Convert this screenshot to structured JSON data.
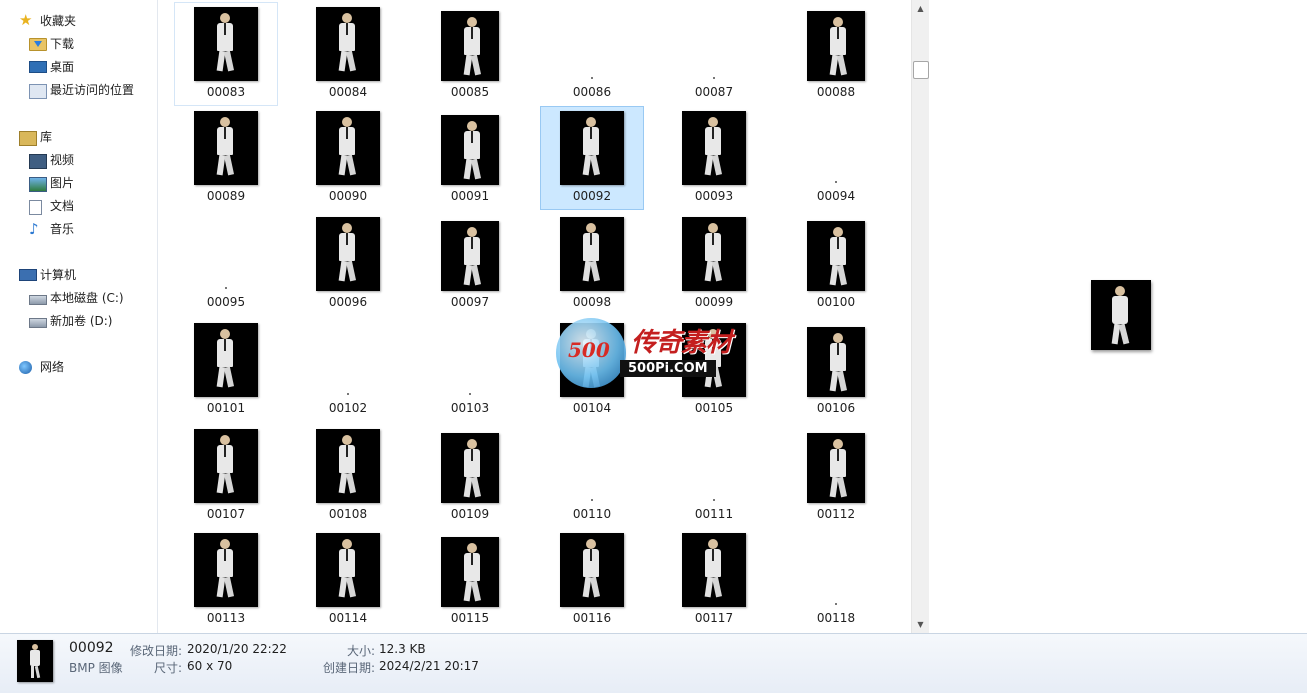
{
  "nav": {
    "favorites": {
      "label": "收藏夹",
      "items": [
        {
          "label": "下载"
        },
        {
          "label": "桌面"
        },
        {
          "label": "最近访问的位置"
        }
      ]
    },
    "libraries": {
      "label": "库",
      "items": [
        {
          "label": "视频"
        },
        {
          "label": "图片"
        },
        {
          "label": "文档"
        },
        {
          "label": "音乐"
        }
      ]
    },
    "computer": {
      "label": "计算机",
      "items": [
        {
          "label": "本地磁盘 (C:)"
        },
        {
          "label": "新加卷 (D:)"
        }
      ]
    },
    "network": {
      "label": "网络"
    }
  },
  "files": [
    {
      "name": "00083",
      "thumb": true,
      "state": "hover"
    },
    {
      "name": "00084",
      "thumb": true
    },
    {
      "name": "00085",
      "thumb": true
    },
    {
      "name": "00086",
      "thumb": false
    },
    {
      "name": "00087",
      "thumb": false
    },
    {
      "name": "00088",
      "thumb": true
    },
    {
      "name": "00089",
      "thumb": true
    },
    {
      "name": "00090",
      "thumb": true
    },
    {
      "name": "00091",
      "thumb": true
    },
    {
      "name": "00092",
      "thumb": true,
      "state": "selected"
    },
    {
      "name": "00093",
      "thumb": true
    },
    {
      "name": "00094",
      "thumb": false
    },
    {
      "name": "00095",
      "thumb": false
    },
    {
      "name": "00096",
      "thumb": true
    },
    {
      "name": "00097",
      "thumb": true
    },
    {
      "name": "00098",
      "thumb": true
    },
    {
      "name": "00099",
      "thumb": true
    },
    {
      "name": "00100",
      "thumb": true
    },
    {
      "name": "00101",
      "thumb": true
    },
    {
      "name": "00102",
      "thumb": false
    },
    {
      "name": "00103",
      "thumb": false
    },
    {
      "name": "00104",
      "thumb": true
    },
    {
      "name": "00105",
      "thumb": true
    },
    {
      "name": "00106",
      "thumb": true
    },
    {
      "name": "00107",
      "thumb": true
    },
    {
      "name": "00108",
      "thumb": true
    },
    {
      "name": "00109",
      "thumb": true
    },
    {
      "name": "00110",
      "thumb": false
    },
    {
      "name": "00111",
      "thumb": false
    },
    {
      "name": "00112",
      "thumb": true
    },
    {
      "name": "00113",
      "thumb": true
    },
    {
      "name": "00114",
      "thumb": true
    },
    {
      "name": "00115",
      "thumb": true
    },
    {
      "name": "00116",
      "thumb": true
    },
    {
      "name": "00117",
      "thumb": true
    },
    {
      "name": "00118",
      "thumb": false
    }
  ],
  "watermark": {
    "numerals": "500",
    "chinese": "传奇素材",
    "url": "500Pi.COM"
  },
  "details": {
    "filename": "00092",
    "filetype": "BMP 图像",
    "modified_label": "修改日期:",
    "modified_value": "2020/1/20 22:22",
    "dimensions_label": "尺寸:",
    "dimensions_value": "60 x 70",
    "size_label": "大小:",
    "size_value": "12.3 KB",
    "created_label": "创建日期:",
    "created_value": "2024/2/21 20:17"
  },
  "scrollbar": {
    "up_icon": "▲",
    "down_icon": "▼"
  }
}
